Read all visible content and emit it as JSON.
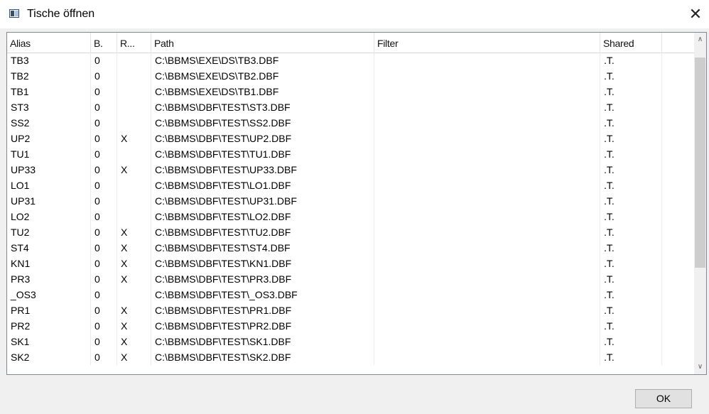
{
  "window": {
    "title": "Tische öffnen",
    "close_glyph": "✕"
  },
  "table": {
    "columns": [
      "Alias",
      "B.",
      "R...",
      "Path",
      "Filter",
      "Shared",
      ""
    ],
    "rows": [
      [
        "TB3",
        "0",
        "",
        "C:\\BBMS\\EXE\\DS\\TB3.DBF",
        "",
        ".T.",
        ""
      ],
      [
        "TB2",
        "0",
        "",
        "C:\\BBMS\\EXE\\DS\\TB2.DBF",
        "",
        ".T.",
        ""
      ],
      [
        "TB1",
        "0",
        "",
        "C:\\BBMS\\EXE\\DS\\TB1.DBF",
        "",
        ".T.",
        ""
      ],
      [
        "ST3",
        "0",
        "",
        "C:\\BBMS\\DBF\\TEST\\ST3.DBF",
        "",
        ".T.",
        ""
      ],
      [
        "SS2",
        "0",
        "",
        "C:\\BBMS\\DBF\\TEST\\SS2.DBF",
        "",
        ".T.",
        ""
      ],
      [
        "UP2",
        "0",
        "X",
        "C:\\BBMS\\DBF\\TEST\\UP2.DBF",
        "",
        ".T.",
        ""
      ],
      [
        "TU1",
        "0",
        "",
        "C:\\BBMS\\DBF\\TEST\\TU1.DBF",
        "",
        ".T.",
        ""
      ],
      [
        "UP33",
        "0",
        "X",
        "C:\\BBMS\\DBF\\TEST\\UP33.DBF",
        "",
        ".T.",
        ""
      ],
      [
        "LO1",
        "0",
        "",
        "C:\\BBMS\\DBF\\TEST\\LO1.DBF",
        "",
        ".T.",
        ""
      ],
      [
        "UP31",
        "0",
        "",
        "C:\\BBMS\\DBF\\TEST\\UP31.DBF",
        "",
        ".T.",
        ""
      ],
      [
        "LO2",
        "0",
        "",
        "C:\\BBMS\\DBF\\TEST\\LO2.DBF",
        "",
        ".T.",
        ""
      ],
      [
        "TU2",
        "0",
        "X",
        "C:\\BBMS\\DBF\\TEST\\TU2.DBF",
        "",
        ".T.",
        ""
      ],
      [
        "ST4",
        "0",
        "X",
        "C:\\BBMS\\DBF\\TEST\\ST4.DBF",
        "",
        ".T.",
        ""
      ],
      [
        "KN1",
        "0",
        "X",
        "C:\\BBMS\\DBF\\TEST\\KN1.DBF",
        "",
        ".T.",
        ""
      ],
      [
        "PR3",
        "0",
        "X",
        "C:\\BBMS\\DBF\\TEST\\PR3.DBF",
        "",
        ".T.",
        ""
      ],
      [
        "_OS3",
        "0",
        "",
        "C:\\BBMS\\DBF\\TEST\\_OS3.DBF",
        "",
        ".T.",
        ""
      ],
      [
        "PR1",
        "0",
        "X",
        "C:\\BBMS\\DBF\\TEST\\PR1.DBF",
        "",
        ".T.",
        ""
      ],
      [
        "PR2",
        "0",
        "X",
        "C:\\BBMS\\DBF\\TEST\\PR2.DBF",
        "",
        ".T.",
        ""
      ],
      [
        "SK1",
        "0",
        "X",
        "C:\\BBMS\\DBF\\TEST\\SK1.DBF",
        "",
        ".T.",
        ""
      ],
      [
        "SK2",
        "0",
        "X",
        "C:\\BBMS\\DBF\\TEST\\SK2.DBF",
        "",
        ".T.",
        ""
      ]
    ]
  },
  "scrollbar": {
    "up_glyph": "∧",
    "down_glyph": "∨"
  },
  "buttons": {
    "ok_label": "OK"
  }
}
